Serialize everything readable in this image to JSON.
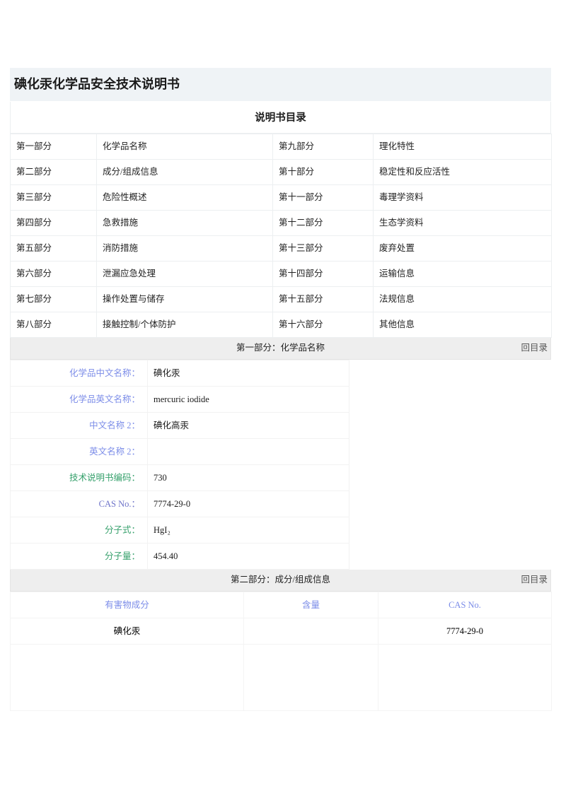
{
  "document": {
    "title": "碘化汞化学品安全技术说明书",
    "toc_caption": "说明书目录",
    "back_to_toc": "回目录"
  },
  "toc": {
    "rows": [
      {
        "left_no": "第一部分",
        "left_name": "化学品名称",
        "right_no": "第九部分",
        "right_name": "理化特性"
      },
      {
        "left_no": "第二部分",
        "left_name": "成分/组成信息",
        "right_no": "第十部分",
        "right_name": "稳定性和反应活性"
      },
      {
        "left_no": "第三部分",
        "left_name": "危险性概述",
        "right_no": "第十一部分",
        "right_name": "毒理学资料"
      },
      {
        "left_no": "第四部分",
        "left_name": "急救措施",
        "right_no": "第十二部分",
        "right_name": "生态学资料"
      },
      {
        "left_no": "第五部分",
        "left_name": "消防措施",
        "right_no": "第十三部分",
        "right_name": "废弃处置"
      },
      {
        "left_no": "第六部分",
        "left_name": "泄漏应急处理",
        "right_no": "第十四部分",
        "right_name": "运输信息"
      },
      {
        "left_no": "第七部分",
        "left_name": "操作处置与储存",
        "right_no": "第十五部分",
        "right_name": "法规信息"
      },
      {
        "left_no": "第八部分",
        "left_name": "接触控制/个体防护",
        "right_no": "第十六部分",
        "right_name": "其他信息"
      }
    ]
  },
  "section1": {
    "band": "第一部分：化学品名称",
    "fields": [
      {
        "label": "化学品中文名称：",
        "value": "碘化汞"
      },
      {
        "label": "化学品英文名称：",
        "value": "mercuric iodide"
      },
      {
        "label": "中文名称 2：",
        "value": "碘化高汞"
      },
      {
        "label": "英文名称 2：",
        "value": ""
      },
      {
        "label": "技术说明书编码：",
        "value": "730"
      },
      {
        "label": "CAS No.：",
        "value": "7774-29-0"
      },
      {
        "label": "分子式：",
        "value": "HgI₂"
      },
      {
        "label": "分子量：",
        "value": "454.40"
      }
    ]
  },
  "section2": {
    "band": "第二部分：成分/组成信息",
    "headers": [
      "有害物成分",
      "含量",
      "CAS No."
    ],
    "rows": [
      {
        "component": "碘化汞",
        "content": "",
        "cas": "7774-29-0"
      }
    ]
  },
  "colors": {
    "title_bg": "#eff3f6",
    "band_bg": "#eeeeee",
    "label_blue": "#7b8ce8",
    "label_green": "#35a06b",
    "label_purple": "#6f74c9",
    "border": "#eceff1"
  }
}
